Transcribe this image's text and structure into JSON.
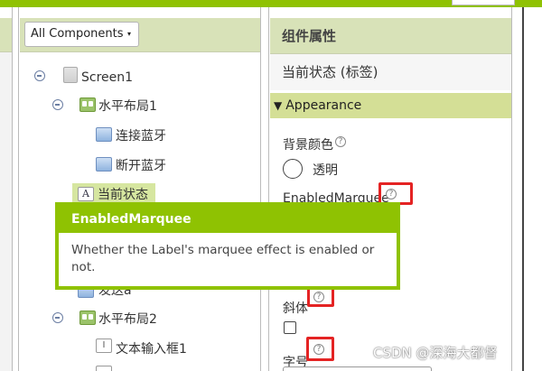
{
  "palette": {
    "brand_green": "#8fc202",
    "header_green": "#d8e2b8",
    "section_green": "#d4df96",
    "highlight_red": "#e42323"
  },
  "components": {
    "dropdown_label": "All Components",
    "dropdown_caret": "▾",
    "tree": [
      {
        "label": "Screen1",
        "icon": "screen-icon",
        "expanded": true
      },
      {
        "label": "水平布局1",
        "icon": "horizontal-layout-icon",
        "expanded": true
      },
      {
        "label": "连接蓝牙",
        "icon": "button-icon"
      },
      {
        "label": "断开蓝牙",
        "icon": "button-icon"
      },
      {
        "label": "当前状态",
        "icon": "label-icon",
        "selected": true
      },
      {
        "label": "发送a",
        "icon": "button-icon"
      },
      {
        "label": "水平布局2",
        "icon": "horizontal-layout-icon",
        "expanded": true
      },
      {
        "label": "文本输入框1",
        "icon": "textbox-icon"
      }
    ],
    "label_icon_glyph": "A",
    "textbox_icon_glyph": "I"
  },
  "properties": {
    "title": "组件属性",
    "component": "当前状态 (标签)",
    "section": "Appearance",
    "section_arrow": "▼",
    "help_glyph": "?",
    "background_color_label": "背景颜色",
    "background_color_value": "透明",
    "enabled_marquee_label": "EnabledMarquee",
    "italic_label": "斜体",
    "font_size_label": "字号"
  },
  "tooltip": {
    "title": "EnabledMarquee",
    "body": "Whether the Label's marquee effect is enabled or not."
  },
  "watermark": "CSDN @深海大都督"
}
